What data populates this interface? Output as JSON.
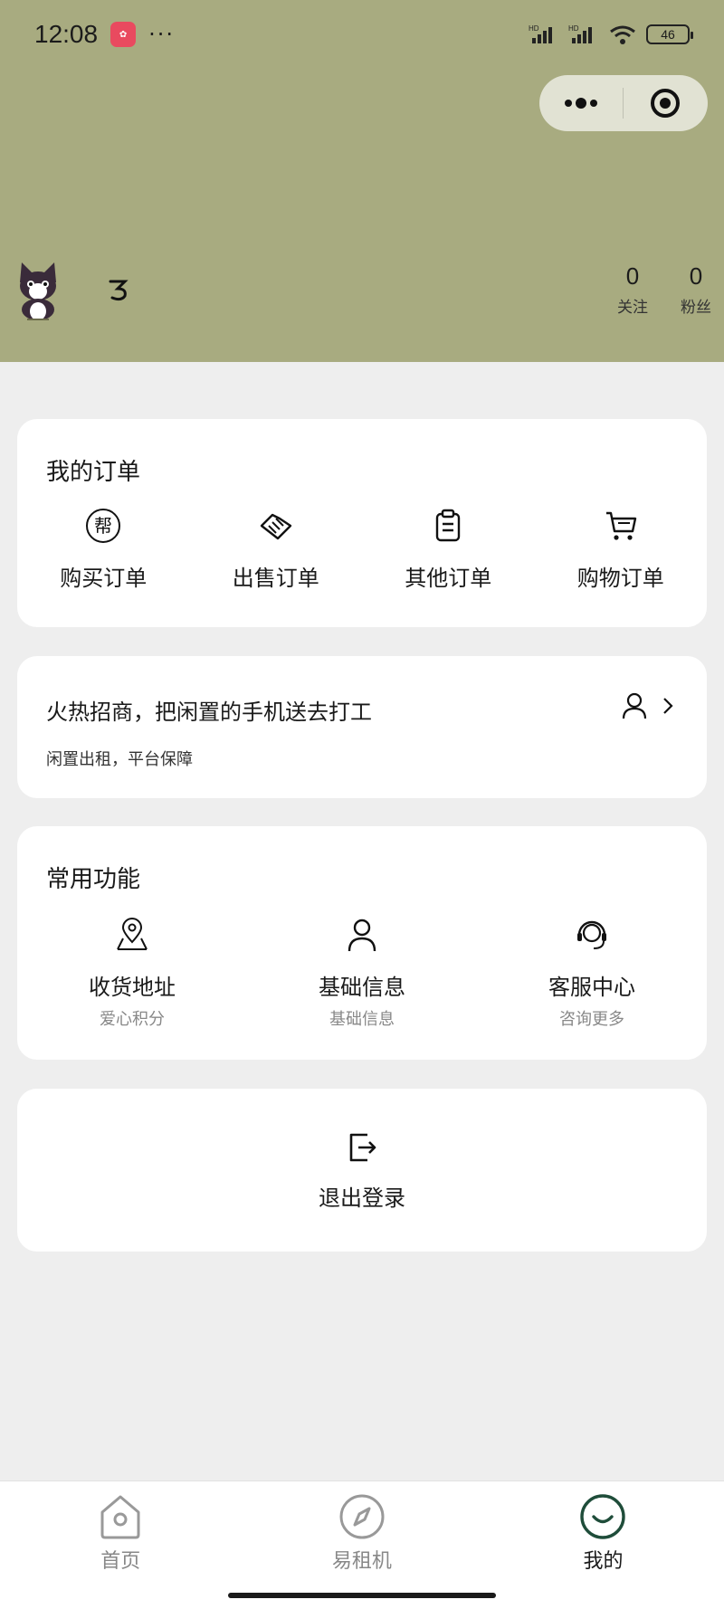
{
  "status_bar": {
    "time": "12:08",
    "battery": "46",
    "more": "···"
  },
  "capsule": {
    "menu_icon": "more-dots-icon",
    "close_icon": "target-icon"
  },
  "profile": {
    "stats": [
      {
        "num": "0",
        "label": "关注"
      },
      {
        "num": "0",
        "label": "粉丝"
      }
    ]
  },
  "orders": {
    "title": "我的订单",
    "items": [
      {
        "label": "购买订单",
        "icon": "bang-icon"
      },
      {
        "label": "出售订单",
        "icon": "handshake-icon"
      },
      {
        "label": "其他订单",
        "icon": "clipboard-icon"
      },
      {
        "label": "购物订单",
        "icon": "cart-icon"
      }
    ]
  },
  "promo": {
    "title": "火热招商，把闲置的手机送去打工",
    "subtitle": "闲置出租，平台保障"
  },
  "functions": {
    "title": "常用功能",
    "items": [
      {
        "label": "收货地址",
        "sub": "爱心积分",
        "icon": "location-icon"
      },
      {
        "label": "基础信息",
        "sub": "基础信息",
        "icon": "user-icon"
      },
      {
        "label": "客服中心",
        "sub": "咨询更多",
        "icon": "headset-icon"
      }
    ]
  },
  "logout": {
    "label": "退出登录",
    "icon": "logout-icon"
  },
  "tabbar": {
    "items": [
      {
        "label": "首页",
        "icon": "home-icon"
      },
      {
        "label": "易租机",
        "icon": "compass-icon"
      },
      {
        "label": "我的",
        "icon": "smile-icon",
        "active": true
      }
    ]
  },
  "colors": {
    "header_bg": "#a8ab80",
    "page_bg": "#eeeeee",
    "active_tab": "#1f4d3a"
  }
}
